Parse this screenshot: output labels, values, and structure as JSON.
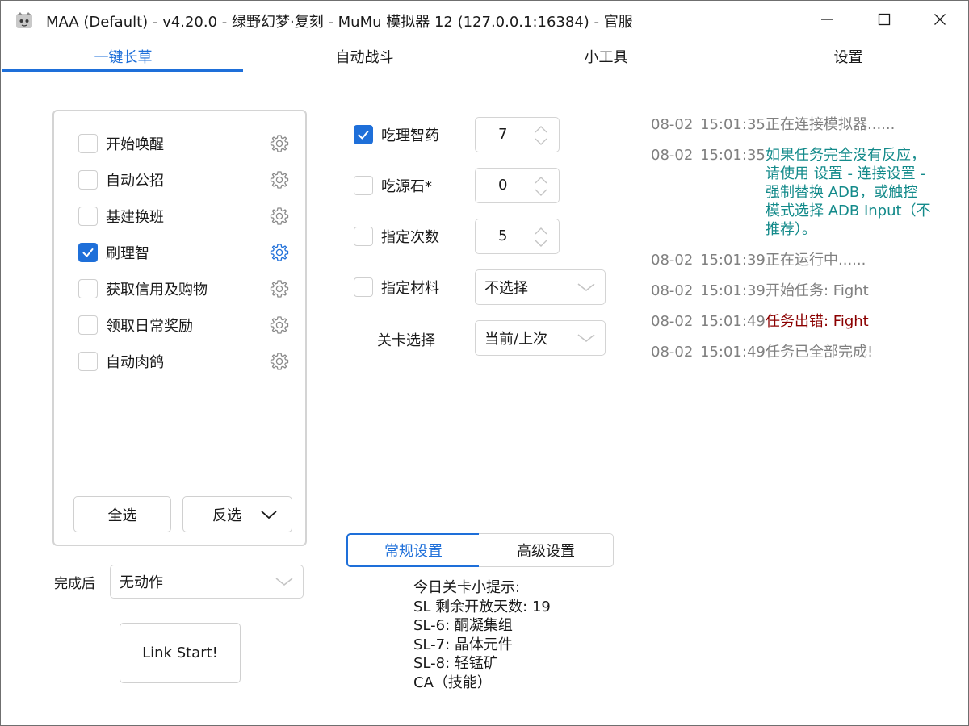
{
  "window": {
    "title": "MAA (Default) - v4.20.0 - 绿野幻梦·复刻 - MuMu 模拟器 12 (127.0.0.1:16384) - 官服"
  },
  "tabs": [
    {
      "label": "一键长草",
      "active": true
    },
    {
      "label": "自动战斗",
      "active": false
    },
    {
      "label": "小工具",
      "active": false
    },
    {
      "label": "设置",
      "active": false
    }
  ],
  "tasks": [
    {
      "label": "开始唤醒",
      "checked": false
    },
    {
      "label": "自动公招",
      "checked": false
    },
    {
      "label": "基建换班",
      "checked": false
    },
    {
      "label": "刷理智",
      "checked": true
    },
    {
      "label": "获取信用及购物",
      "checked": false
    },
    {
      "label": "领取日常奖励",
      "checked": false
    },
    {
      "label": "自动肉鸽",
      "checked": false
    }
  ],
  "task_buttons": {
    "select_all": "全选",
    "invert": "反选"
  },
  "after_complete": {
    "label": "完成后",
    "value": "无动作"
  },
  "start_button": "Link Start!",
  "options": {
    "sanity_medicine": {
      "label": "吃理智药",
      "checked": true,
      "value": "7"
    },
    "originite": {
      "label": "吃源石*",
      "checked": false,
      "value": "0"
    },
    "times": {
      "label": "指定次数",
      "checked": false,
      "value": "5"
    },
    "material": {
      "label": "指定材料",
      "checked": false,
      "value": "不选择"
    },
    "stage": {
      "label": "关卡选择",
      "value": "当前/上次"
    }
  },
  "settings_tabs": {
    "normal": "常规设置",
    "advanced": "高级设置"
  },
  "tips": [
    "今日关卡小提示:",
    "SL 剩余开放天数: 19",
    "SL-6: 酮凝集组",
    "SL-7: 晶体元件",
    "SL-8: 轻锰矿",
    "CA（技能）"
  ],
  "log": [
    {
      "date": "08-02",
      "time": "15:01:35",
      "message": "正在连接模拟器......",
      "color": "#808080"
    },
    {
      "date": "08-02",
      "time": "15:01:35",
      "message": "如果任务完全没有反应，\n请使用 设置 - 连接设置 -\n强制替换 ADB，或触控\n模式选择 ADB Input（不\n推荐）。",
      "color": "#138a8a"
    },
    {
      "date": "08-02",
      "time": "15:01:39",
      "message": "正在运行中......",
      "color": "#808080"
    },
    {
      "date": "08-02",
      "time": "15:01:39",
      "message": "开始任务: Fight",
      "color": "#808080"
    },
    {
      "date": "08-02",
      "time": "15:01:49",
      "message": "任务出错: Fight",
      "color": "#8b0000"
    },
    {
      "date": "08-02",
      "time": "15:01:49",
      "message": "任务已全部完成!",
      "color": "#808080"
    }
  ],
  "colors": {
    "accent": "#1e6fd9",
    "log_gray": "#808080",
    "log_teal": "#138a8a",
    "log_error": "#8b0000"
  }
}
